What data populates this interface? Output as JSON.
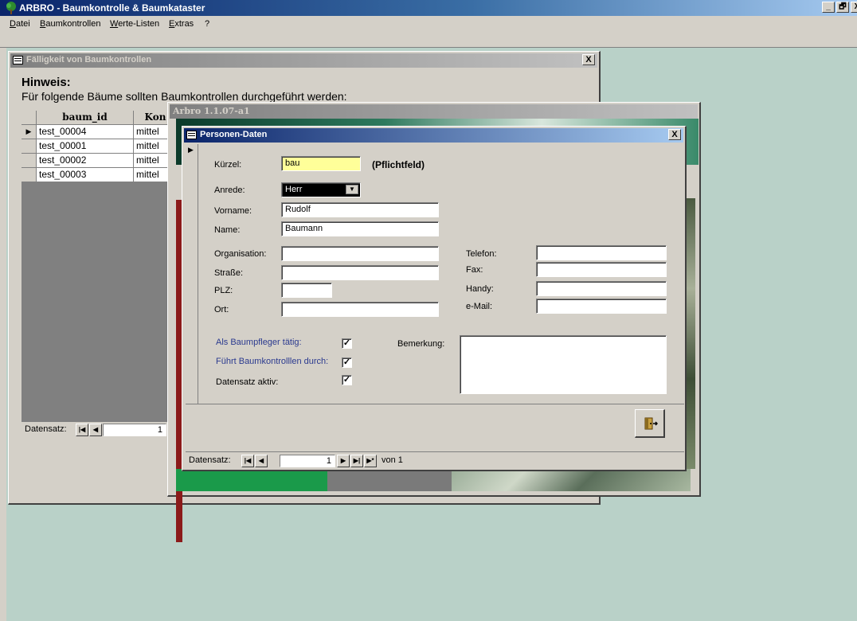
{
  "app": {
    "title": "ARBRO - Baumkontrolle & Baumkataster",
    "min_label": "_",
    "restore_label": "🗗",
    "close_label": "X"
  },
  "menubar": {
    "items": [
      "Datei",
      "Baumkontrollen",
      "Werte-Listen",
      "Extras",
      "?"
    ]
  },
  "faelligkeit": {
    "title": "Fälligkeit von Baumkontrollen",
    "close_label": "X",
    "hinweis_label": "Hinweis:",
    "hinweis_text": "Für folgende Bäume sollten Baumkontrollen durchgeführt werden:",
    "columns": [
      "baum_id",
      "Kon"
    ],
    "rows": [
      {
        "baum_id": "test_00004",
        "kon": "mittel"
      },
      {
        "baum_id": "test_00001",
        "kon": "mittel"
      },
      {
        "baum_id": "test_00002",
        "kon": "mittel"
      },
      {
        "baum_id": "test_00003",
        "kon": "mittel"
      }
    ],
    "nav_label": "Datensatz:",
    "nav_value": "1"
  },
  "arbro_window": {
    "title": "Arbro 1.1.07-a1"
  },
  "personen": {
    "title": "Personen-Daten",
    "close_label": "X",
    "fields": {
      "kuerzel_label": "Kürzel:",
      "kuerzel_value": "bau",
      "pflicht_label": "(Pflichtfeld)",
      "anrede_label": "Anrede:",
      "anrede_value": "Herr",
      "vorname_label": "Vorname:",
      "vorname_value": "Rudolf",
      "name_label": "Name:",
      "name_value": "Baumann",
      "organisation_label": "Organisation:",
      "organisation_value": "",
      "strasse_label": "Straße:",
      "strasse_value": "",
      "plz_label": "PLZ:",
      "plz_value": "",
      "ort_label": "Ort:",
      "ort_value": "",
      "telefon_label": "Telefon:",
      "telefon_value": "",
      "fax_label": "Fax:",
      "fax_value": "",
      "handy_label": "Handy:",
      "handy_value": "",
      "email_label": "e-Mail:",
      "email_value": "",
      "baumpfleger_label": "Als Baumpfleger tätig:",
      "baumpfleger_checked": true,
      "kontrollen_label": "Führt Baumkontrolllen durch:",
      "kontrollen_checked": true,
      "aktiv_label": "Datensatz aktiv:",
      "aktiv_checked": true,
      "bemerkung_label": "Bemerkung:",
      "bemerkung_value": ""
    },
    "nav": {
      "label": "Datensatz:",
      "value": "1",
      "von_label": "von 1"
    },
    "check_glyph": "✓"
  },
  "colors": {
    "title_active": "#0a246a",
    "title_inactive": "#808080",
    "desktop": "#b9d1c8",
    "face": "#d4d0c8",
    "kuerzel_bg": "#ffff99",
    "blue_label": "#2b3a8f"
  },
  "icons": [
    "tree-icon",
    "form-icon",
    "exit-door-icon",
    "record-pointer-icon"
  ]
}
